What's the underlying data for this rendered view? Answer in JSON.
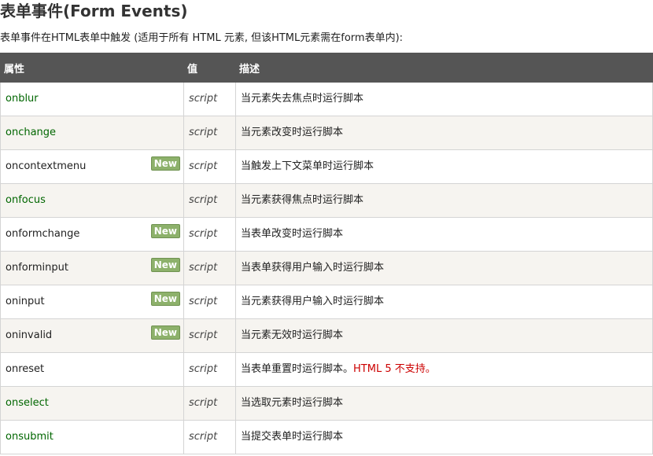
{
  "page": {
    "title": "表单事件(Form Events)",
    "intro": "表单事件在HTML表单中触发 (适用于所有 HTML 元素, 但该HTML元素需在form表单内):"
  },
  "table": {
    "headers": [
      "属性",
      "值",
      "描述"
    ],
    "rows": [
      {
        "attr": "onblur",
        "link": true,
        "isNew": false,
        "value": "script",
        "desc": "当元素失去焦点时运行脚本"
      },
      {
        "attr": "onchange",
        "link": true,
        "isNew": false,
        "value": "script",
        "desc": "当元素改变时运行脚本"
      },
      {
        "attr": "oncontextmenu",
        "link": false,
        "isNew": true,
        "value": "script",
        "desc": "当触发上下文菜单时运行脚本"
      },
      {
        "attr": "onfocus",
        "link": true,
        "isNew": false,
        "value": "script",
        "desc": "当元素获得焦点时运行脚本"
      },
      {
        "attr": "onformchange",
        "link": false,
        "isNew": true,
        "value": "script",
        "desc": "当表单改变时运行脚本"
      },
      {
        "attr": "onforminput",
        "link": false,
        "isNew": true,
        "value": "script",
        "desc": "当表单获得用户输入时运行脚本"
      },
      {
        "attr": "oninput",
        "link": false,
        "isNew": true,
        "value": "script",
        "desc": "当元素获得用户输入时运行脚本"
      },
      {
        "attr": "oninvalid",
        "link": false,
        "isNew": true,
        "value": "script",
        "desc": "当元素无效时运行脚本"
      },
      {
        "attr": "onreset",
        "link": false,
        "isNew": false,
        "value": "script",
        "desc": "当表单重置时运行脚本。",
        "note": "HTML 5 不支持。"
      },
      {
        "attr": "onselect",
        "link": true,
        "isNew": false,
        "value": "script",
        "desc": "当选取元素时运行脚本"
      },
      {
        "attr": "onsubmit",
        "link": true,
        "isNew": false,
        "value": "script",
        "desc": "当提交表单时运行脚本"
      }
    ],
    "new_badge_label": "New"
  },
  "colors": {
    "header_bg": "#555555",
    "link": "#006600",
    "warning": "#cc0000",
    "badge": "#8db16b",
    "alt_row": "#f6f4f0"
  }
}
